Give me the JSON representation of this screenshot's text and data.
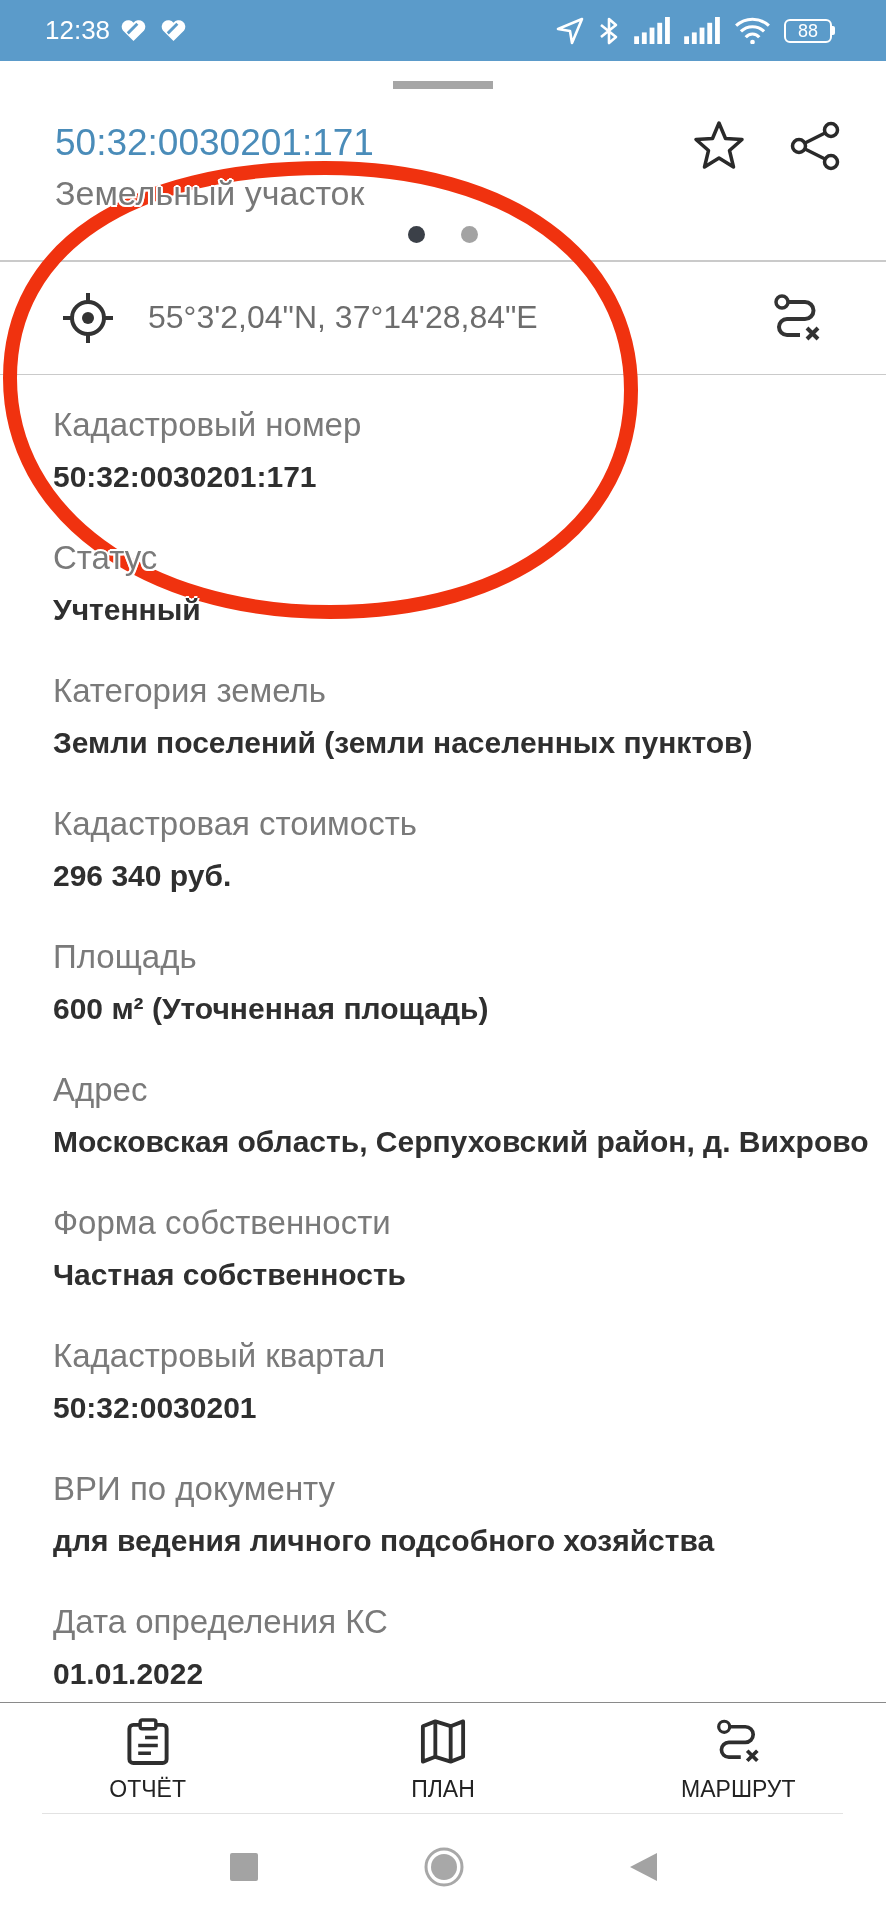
{
  "status_bar": {
    "time": "12:38",
    "battery": "88"
  },
  "sheet": {
    "title": "50:32:0030201:171",
    "subtitle": "Земельный участок",
    "favorite": false,
    "pages": [
      {
        "selected": true
      },
      {
        "selected": false
      }
    ]
  },
  "location": {
    "coordinates": "55°3'2,04\"N, 37°14'28,84\"E"
  },
  "fields": [
    {
      "label": "Кадастровый номер",
      "value": "50:32:0030201:171"
    },
    {
      "label": "Статус",
      "value": "Учтенный"
    },
    {
      "label": "Категория земель",
      "value": "Земли поселений (земли населенных пунктов)"
    },
    {
      "label": "Кадастровая стоимость",
      "value": "296 340 руб."
    },
    {
      "label": "Площадь",
      "value": "600 м² (Уточненная площадь)"
    },
    {
      "label": "Адрес",
      "value": "Московская область, Серпуховский район, д. Вихрово"
    },
    {
      "label": "Форма собственности",
      "value": "Частная собственность"
    },
    {
      "label": "Кадастровый квартал",
      "value": "50:32:0030201"
    },
    {
      "label": "ВРИ по документу",
      "value": "для ведения личного подсобного хозяйства"
    },
    {
      "label": "Дата определения КС",
      "value": "01.01.2022"
    }
  ],
  "actions": [
    {
      "label": "ОТЧЁТ"
    },
    {
      "label": "ПЛАН"
    },
    {
      "label": "МАРШРУТ"
    }
  ]
}
